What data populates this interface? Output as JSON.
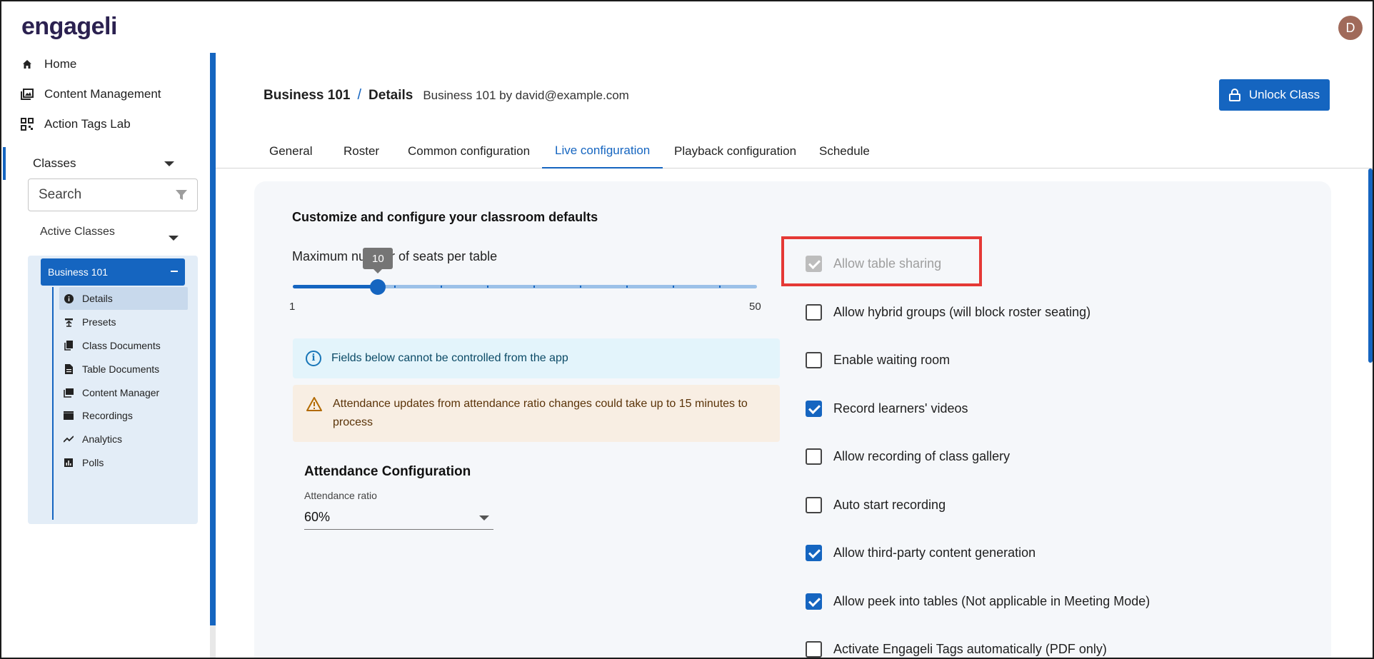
{
  "brand": {
    "logo_text": "engageli",
    "avatar_initial": "D"
  },
  "sidebar": {
    "nav": [
      {
        "label": "Home",
        "icon": "home-icon"
      },
      {
        "label": "Content Management",
        "icon": "photo-library-icon"
      },
      {
        "label": "Action Tags Lab",
        "icon": "qr-code-icon"
      }
    ],
    "classes_label": "Classes",
    "search_placeholder": "Search",
    "active_classes_label": "Active Classes",
    "selected_class": "Business 101",
    "class_items": [
      {
        "label": "Details",
        "icon": "info-icon",
        "selected": true
      },
      {
        "label": "Presets",
        "icon": "preset-icon"
      },
      {
        "label": "Class Documents",
        "icon": "documents-icon"
      },
      {
        "label": "Table Documents",
        "icon": "document-icon"
      },
      {
        "label": "Content Manager",
        "icon": "photo-library-icon"
      },
      {
        "label": "Recordings",
        "icon": "clapperboard-icon"
      },
      {
        "label": "Analytics",
        "icon": "trend-icon"
      },
      {
        "label": "Polls",
        "icon": "bar-chart-icon"
      }
    ]
  },
  "header": {
    "breadcrumb_root": "Business 101",
    "breadcrumb_sep": "/",
    "breadcrumb_current": "Details",
    "subtitle": "Business 101 by david@example.com",
    "unlock_label": "Unlock Class"
  },
  "tabs": [
    {
      "label": "General"
    },
    {
      "label": "Roster"
    },
    {
      "label": "Common configuration"
    },
    {
      "label": "Live configuration",
      "active": true
    },
    {
      "label": "Playback configuration"
    },
    {
      "label": "Schedule"
    }
  ],
  "content": {
    "title": "Customize and configure your classroom defaults",
    "slider": {
      "label": "Maximum number of seats per table",
      "min": 1,
      "max": 50,
      "value": 10,
      "min_label": "1",
      "max_label": "50",
      "value_label": "10"
    },
    "info_alert": "Fields below cannot be controlled from the app",
    "warn_alert": "Attendance updates from attendance ratio changes could take up to 15 minutes to process",
    "attendance": {
      "title": "Attendance Configuration",
      "ratio_label": "Attendance ratio",
      "ratio_value": "60%"
    },
    "options": [
      {
        "label": "Allow table sharing",
        "checked": true,
        "disabled": true
      },
      {
        "label": "Allow hybrid groups (will block roster seating)",
        "checked": false
      },
      {
        "label": "Enable waiting room",
        "checked": false
      },
      {
        "label": "Record learners' videos",
        "checked": true
      },
      {
        "label": "Allow recording of class gallery",
        "checked": false
      },
      {
        "label": "Auto start recording",
        "checked": false
      },
      {
        "label": "Allow third-party content generation",
        "checked": true
      },
      {
        "label": "Allow peek into tables (Not applicable in Meeting Mode)",
        "checked": true
      },
      {
        "label": "Activate Engageli Tags automatically (PDF only)",
        "checked": false
      }
    ]
  },
  "colors": {
    "accent": "#1565c0",
    "highlight": "#e53935"
  }
}
